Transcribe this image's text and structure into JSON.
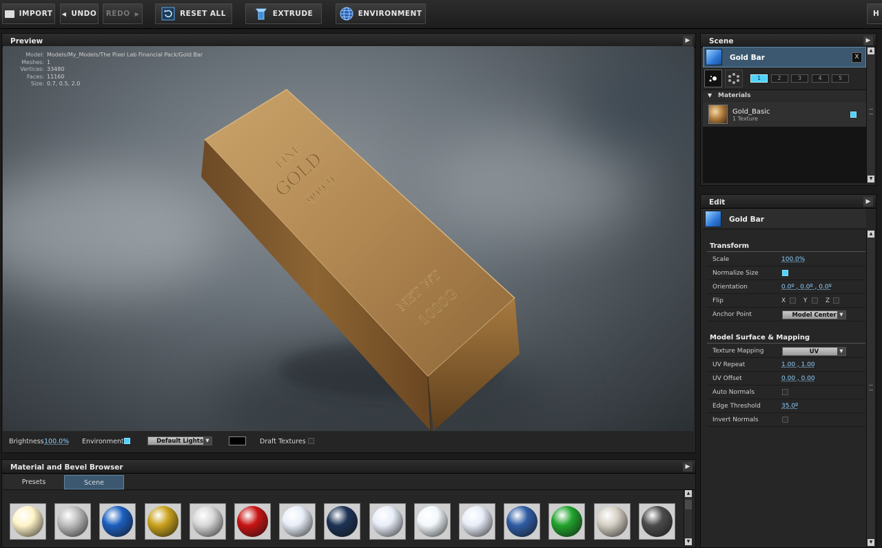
{
  "toolbar": {
    "import": "IMPORT",
    "undo": "UNDO",
    "redo": "REDO",
    "reset_all": "RESET ALL",
    "extrude": "EXTRUDE",
    "environment": "ENVIRONMENT",
    "help": "H"
  },
  "preview": {
    "title": "Preview",
    "stats": [
      {
        "k": "Model:",
        "v": "Models/My_Models/The Pixel Lab Financial Pack/Gold Bar"
      },
      {
        "k": "Meshes:",
        "v": "1"
      },
      {
        "k": "Vertices:",
        "v": "33480"
      },
      {
        "k": "Faces:",
        "v": "11160"
      },
      {
        "k": "Size:",
        "v": "0.7, 0.5, 2.0"
      }
    ],
    "bar_text": {
      "top": "FINE",
      "mid": "GOLD",
      "purity": "999.9",
      "net": "NET WT",
      "weight": "1000G"
    },
    "bottom": {
      "brightness_label": "Brightness",
      "brightness_value": "100.0%",
      "environment_label": "Environment",
      "lights": "Default Lights",
      "draft_label": "Draft Textures"
    }
  },
  "browser": {
    "title": "Material and Bevel Browser",
    "tabs": [
      "Presets",
      "Scene"
    ],
    "swatches": [
      {
        "name": "glow",
        "color": "#fff4c8"
      },
      {
        "name": "silver",
        "color": "#bdbdbd"
      },
      {
        "name": "blue",
        "color": "#1c5fbf"
      },
      {
        "name": "yellow",
        "color": "#c9a21c"
      },
      {
        "name": "chrome-stripes",
        "color": "#d8d8d8"
      },
      {
        "name": "red",
        "color": "#c81414"
      },
      {
        "name": "american-1",
        "color": "#e8eef8"
      },
      {
        "name": "navy",
        "color": "#1d3355"
      },
      {
        "name": "american-2",
        "color": "#e8eef8"
      },
      {
        "name": "white",
        "color": "#f2f8fb"
      },
      {
        "name": "american-3",
        "color": "#e8eef8"
      },
      {
        "name": "blue-logo",
        "color": "#2f5ca4"
      },
      {
        "name": "green",
        "color": "#21a32d"
      },
      {
        "name": "wood",
        "color": "#d5cfc4"
      },
      {
        "name": "dark-gray",
        "color": "#4c4c4c"
      }
    ]
  },
  "scene": {
    "title": "Scene",
    "object": "Gold Bar",
    "close": "X",
    "groups": [
      "1",
      "2",
      "3",
      "4",
      "5"
    ],
    "materials_label": "Materials",
    "material_name": "Gold_Basic",
    "material_sub": "1 Texture"
  },
  "edit": {
    "title": "Edit",
    "object": "Gold Bar",
    "transform_title": "Transform",
    "scale_label": "Scale",
    "scale_value": "100.0%",
    "normalize_label": "Normalize Size",
    "orientation_label": "Orientation",
    "orientation_value": "0.0º , 0.0º , 0.0º",
    "flip_label": "Flip",
    "flip_x": "X",
    "flip_y": "Y",
    "flip_z": "Z",
    "anchor_label": "Anchor Point",
    "anchor_value": "Model Center",
    "surface_title": "Model Surface & Mapping",
    "mapping_label": "Texture Mapping",
    "mapping_value": "UV",
    "uvrepeat_label": "UV Repeat",
    "uvrepeat_value": "1.00 , 1.00",
    "uvoffset_label": "UV Offset",
    "uvoffset_value": "0.00 , 0.00",
    "autonormals_label": "Auto Normals",
    "edge_label": "Edge Threshold",
    "edge_value": "35.0º",
    "invert_label": "Invert Normals"
  },
  "colors": {
    "accent": "#4fd2ff",
    "gold": "#b88a4e"
  }
}
